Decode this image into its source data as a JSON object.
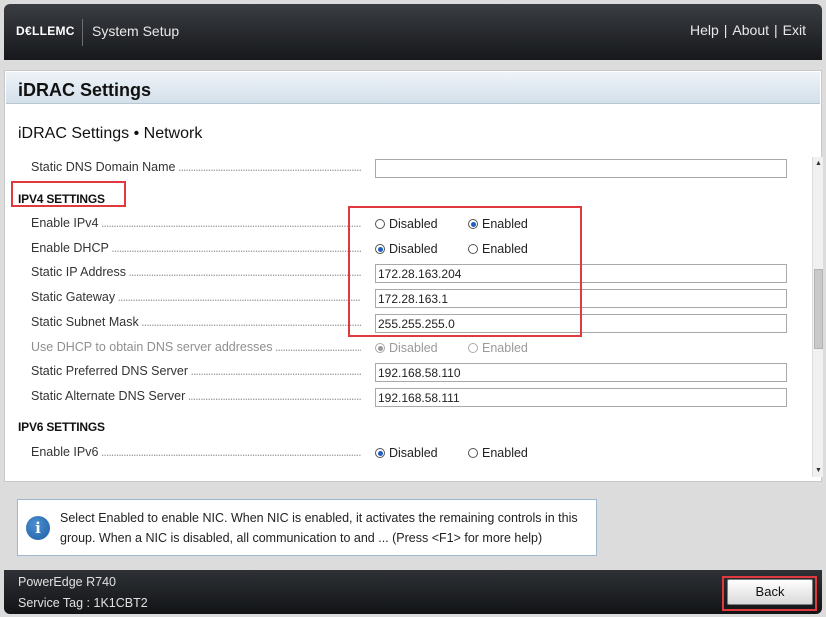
{
  "header": {
    "logo": "D€LLEMC",
    "title": "System Setup",
    "links": [
      "Help",
      "About",
      "Exit"
    ],
    "separator": "|"
  },
  "panel": {
    "title": "iDRAC Settings",
    "page_title": "iDRAC Settings • Network"
  },
  "settings": {
    "dns_domain": {
      "label": "Static DNS Domain Name",
      "value": ""
    },
    "ipv4_section": "IPV4 SETTINGS",
    "enable_ipv4": {
      "label": "Enable IPv4",
      "selected": "Enabled"
    },
    "enable_dhcp": {
      "label": "Enable DHCP",
      "selected": "Disabled"
    },
    "static_ip": {
      "label": "Static IP Address",
      "value": "172.28.163.204"
    },
    "static_gateway": {
      "label": "Static Gateway",
      "value": "172.28.163.1"
    },
    "static_mask": {
      "label": "Static Subnet Mask",
      "value": "255.255.255.0"
    },
    "dhcp_dns": {
      "label": "Use DHCP to obtain DNS server addresses",
      "selected": "Disabled",
      "disabled": true
    },
    "pref_dns": {
      "label": "Static Preferred DNS Server",
      "value": "192.168.58.110"
    },
    "alt_dns": {
      "label": "Static Alternate DNS Server",
      "value": "192.168.58.111"
    },
    "ipv6_section": "IPV6 SETTINGS",
    "enable_ipv6": {
      "label": "Enable IPv6",
      "selected": "Disabled"
    },
    "option_disabled": "Disabled",
    "option_enabled": "Enabled"
  },
  "help": {
    "icon": "info-icon",
    "text": "Select Enabled to enable NIC. When NIC is enabled, it activates the remaining controls in this group. When a NIC is disabled, all communication to and ... (Press <F1> for more help)"
  },
  "footer": {
    "model": "PowerEdge R740",
    "service_tag": "Service Tag : 1K1CBT2",
    "back_label": "Back"
  },
  "colors": {
    "highlight": "#e03a3e",
    "radio_selected": "#1f5fbf",
    "header_bg": "#1c1e21"
  }
}
